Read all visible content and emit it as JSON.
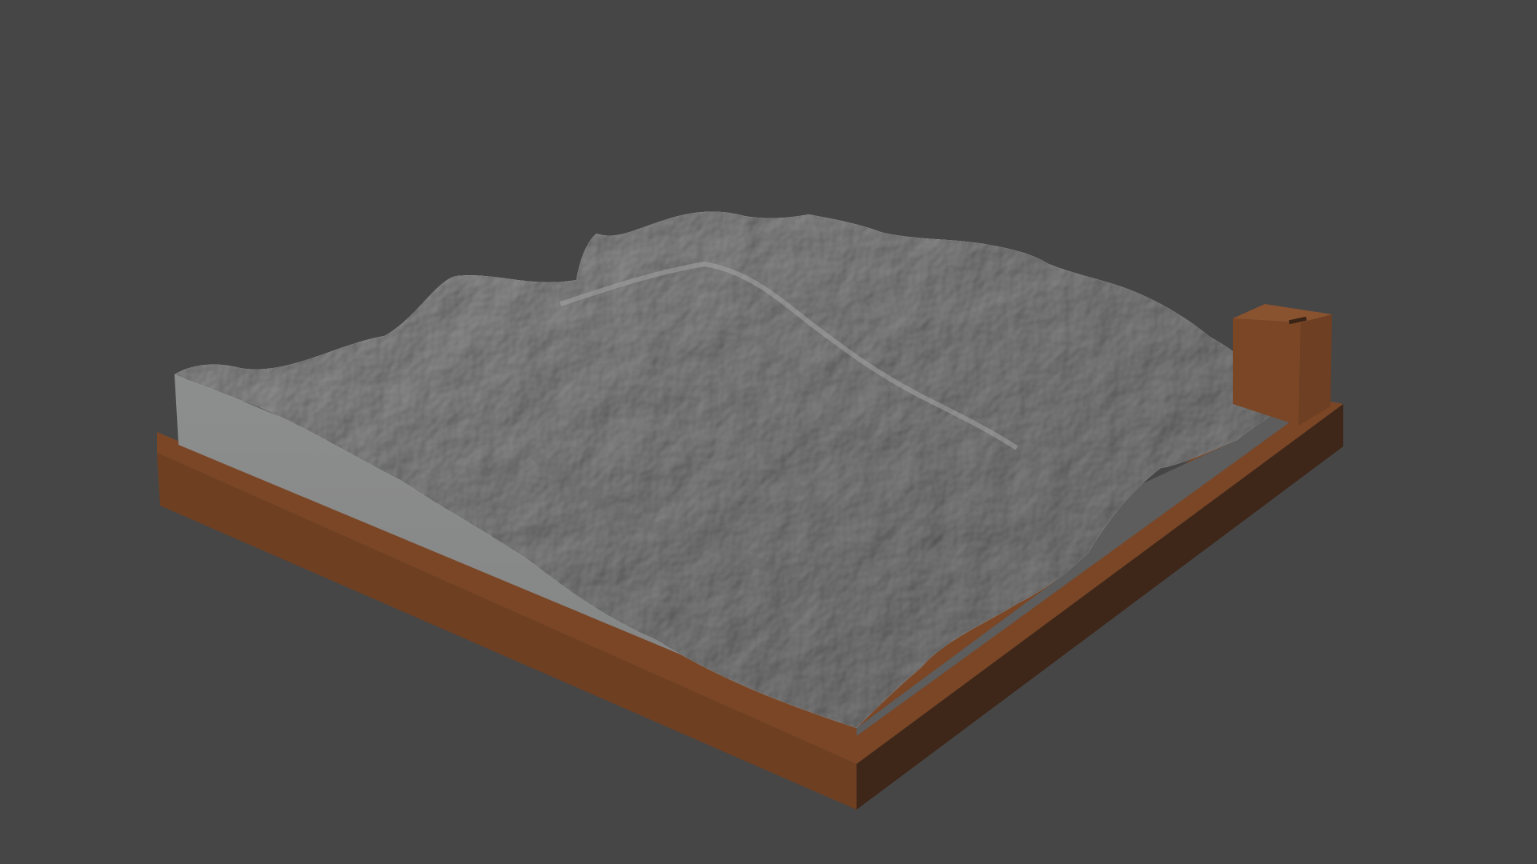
{
  "viewport": {
    "background": "#464646"
  },
  "model": {
    "terrain_color": "#8f8f8f",
    "terrain_side_color": "#8b8c8c",
    "base_top_color": "#7a4626",
    "base_front_color": "#6f3f22",
    "base_side_color": "#3f2719",
    "label_block_color": "#7a4626"
  }
}
